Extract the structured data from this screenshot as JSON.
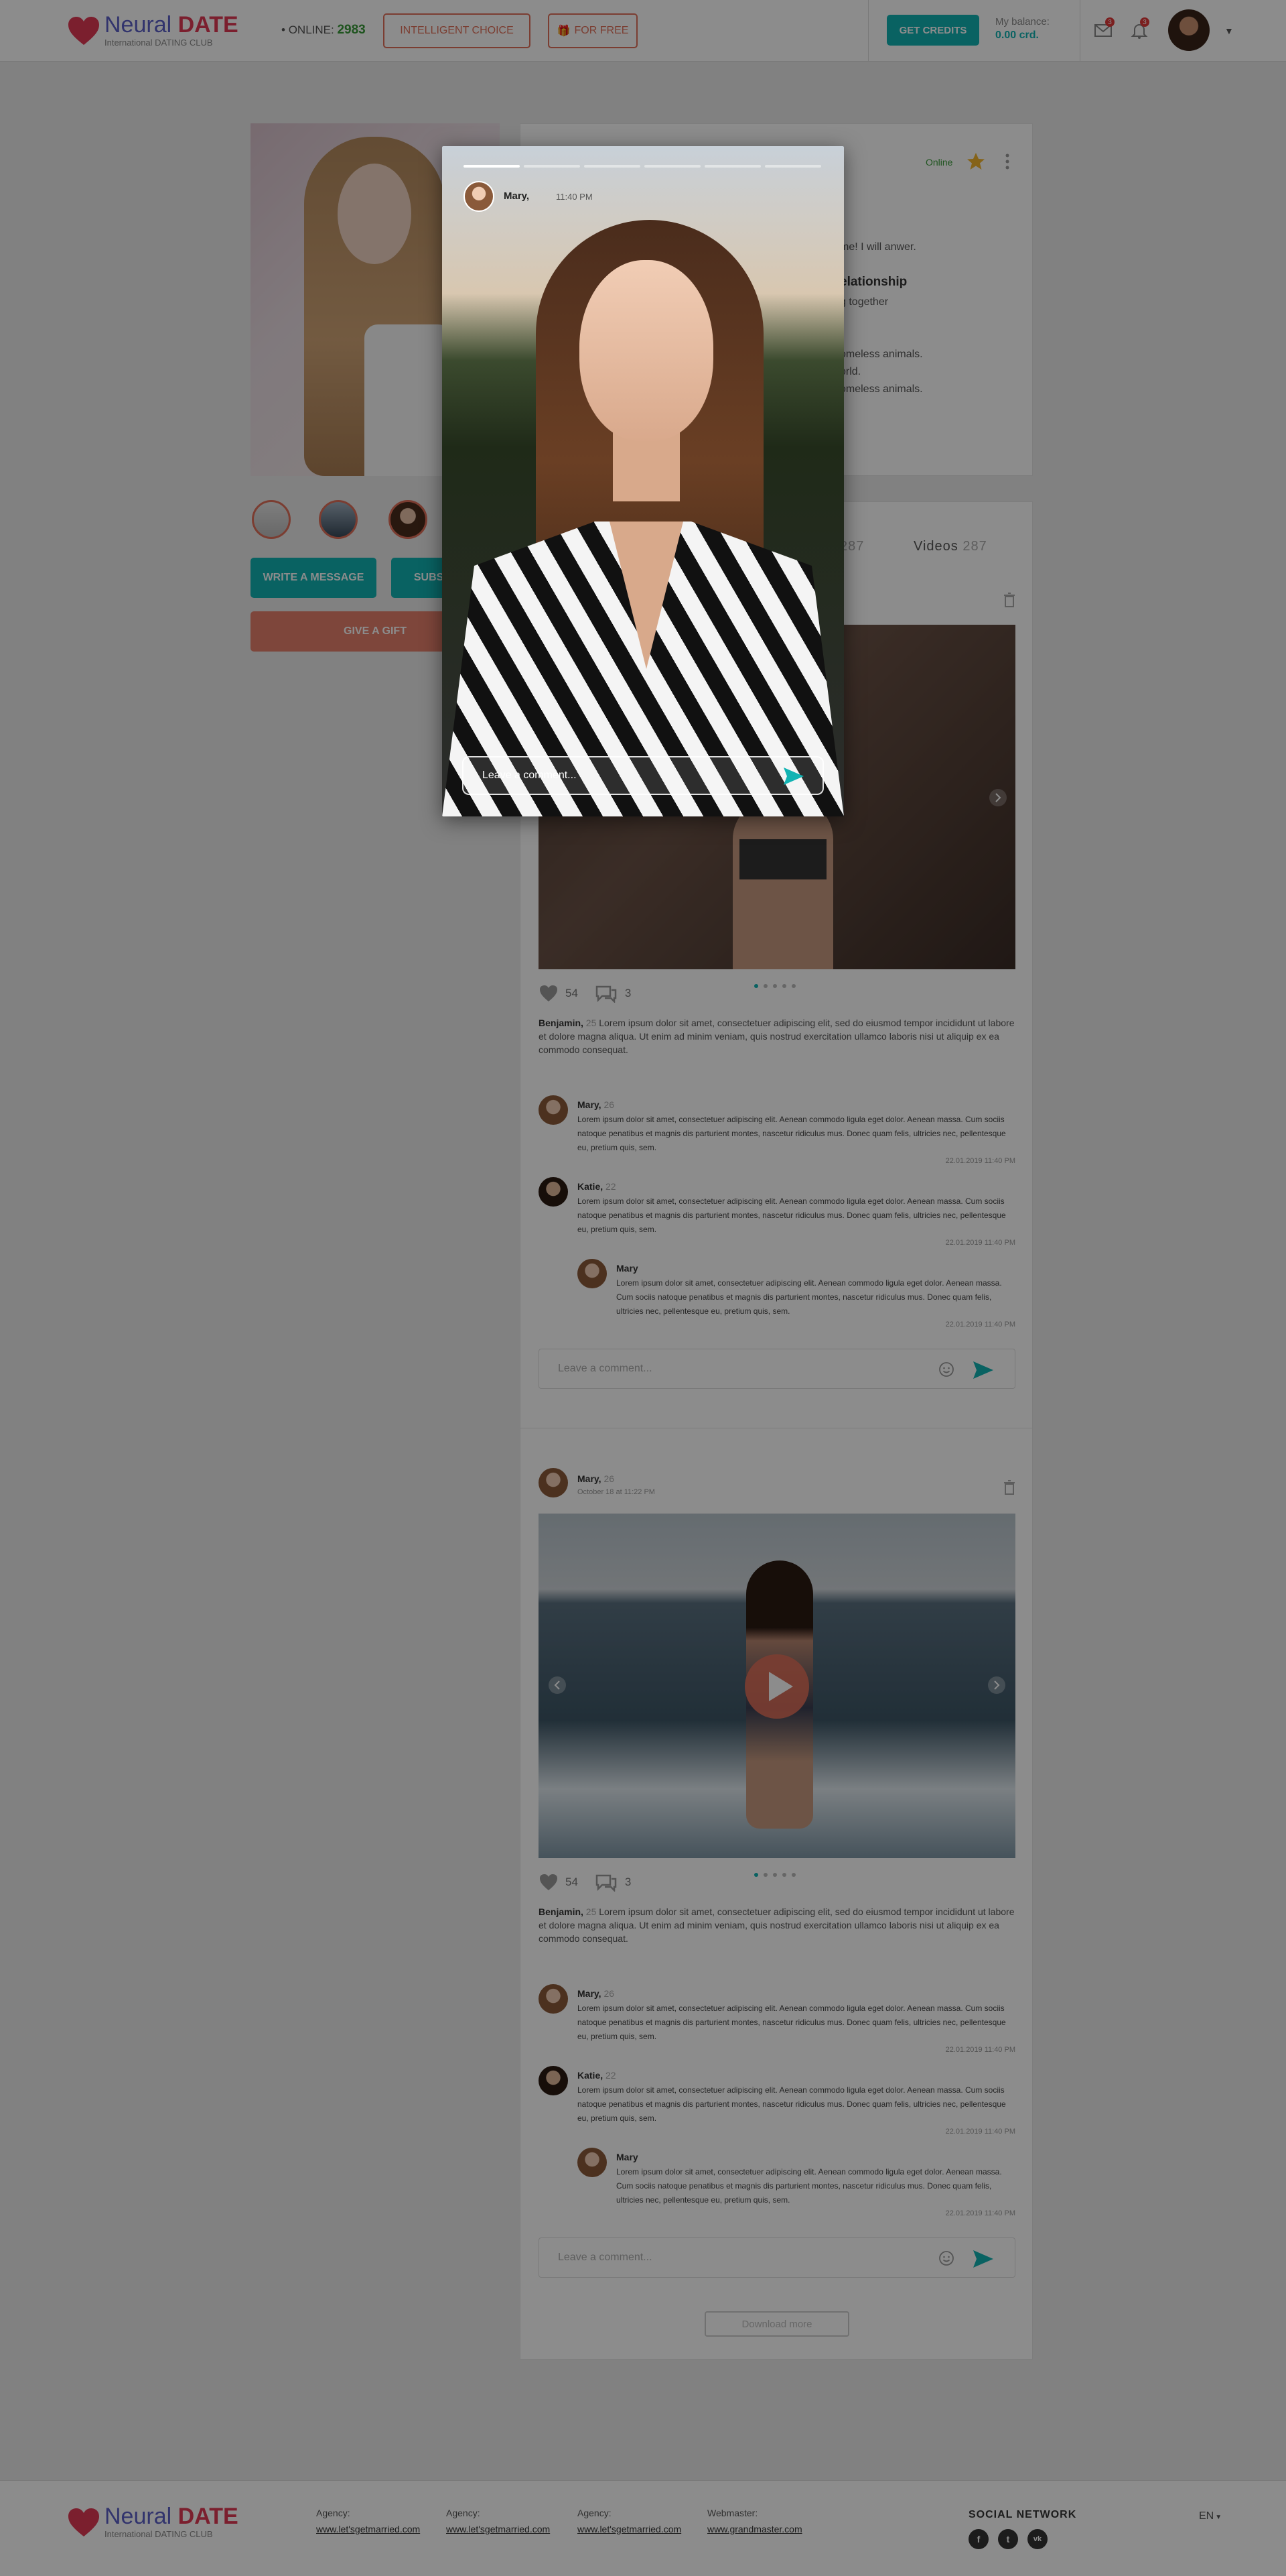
{
  "brand": {
    "name_part1": "Neural",
    "name_part2": "DATE",
    "tagline": "International DATING CLUB",
    "heart_color": "#e03a55"
  },
  "header": {
    "online_label": "ONLINE:",
    "online_count": "2983",
    "intelligent_choice": "INTELLIGENT CHOICE",
    "for_free": "FOR FREE",
    "get_credits": "GET CREDITS",
    "balance_label": "My balance:",
    "balance_value": "0.00 crd.",
    "mail_badge": "3",
    "bell_badge": "3",
    "accent_color": "#12b3b3"
  },
  "profile": {
    "write_message": "WRITE A MESSAGE",
    "subscribe": "SUBSCRIBE",
    "give_gift": "GIVE A GIFT",
    "status": "Online",
    "about_lines": [
      "me! I will anwer."
    ],
    "relationship_heading": "elationship",
    "relationship_lines": [
      "g together"
    ],
    "interest_lines": [
      "omeless animals.",
      "orld.",
      "omeless animals."
    ]
  },
  "tabs": {
    "photos_count": "287",
    "videos_label": "Videos",
    "videos_count": "287"
  },
  "posts": [
    {
      "likes": "54",
      "comments_count": "3",
      "caption_author": "Benjamin,",
      "caption_age": "25",
      "caption": "Lorem ipsum dolor sit amet, consectetuer adipiscing elit, sed do eiusmod tempor incididunt ut labore et dolore magna aliqua. Ut enim ad minim veniam, quis nostrud exercitation ullamco laboris nisi ut aliquip ex ea commodo consequat.",
      "comments": [
        {
          "name": "Mary,",
          "age": "26",
          "text": "Lorem ipsum dolor sit amet, consectetuer adipiscing elit. Aenean commodo ligula eget dolor. Aenean massa. Cum sociis natoque penatibus et magnis dis parturient montes, nascetur ridiculus mus. Donec quam felis, ultricies nec, pellentesque eu, pretium quis, sem.",
          "time": "22.01.2019 11:40 PM"
        },
        {
          "name": "Katie,",
          "age": "22",
          "text": "Lorem ipsum dolor sit amet, consectetuer adipiscing elit. Aenean commodo ligula eget dolor. Aenean massa. Cum sociis natoque penatibus et magnis dis parturient montes, nascetur ridiculus mus. Donec quam felis, ultricies nec, pellentesque eu, pretium quis, sem.",
          "time": "22.01.2019 11:40 PM"
        },
        {
          "name": "Mary",
          "age": "",
          "text": "Lorem ipsum dolor sit amet, consectetuer adipiscing elit. Aenean commodo ligula eget dolor. Aenean massa. Cum sociis natoque penatibus et magnis dis parturient montes, nascetur ridiculus mus. Donec quam felis, ultricies nec, pellentesque eu, pretium quis, sem.",
          "time": "22.01.2019 11:40 PM"
        }
      ],
      "comment_placeholder": "Leave a comment..."
    },
    {
      "author": "Mary,",
      "age": "26",
      "date": "October 18 at 11:22 PM",
      "likes": "54",
      "comments_count": "3",
      "caption_author": "Benjamin,",
      "caption_age": "25",
      "caption": "Lorem ipsum dolor sit amet, consectetuer adipiscing elit, sed do eiusmod tempor incididunt ut labore et dolore magna aliqua. Ut enim ad minim veniam, quis nostrud exercitation ullamco laboris nisi ut aliquip ex ea commodo consequat.",
      "comments": [
        {
          "name": "Mary,",
          "age": "26",
          "text": "Lorem ipsum dolor sit amet, consectetuer adipiscing elit. Aenean commodo ligula eget dolor. Aenean massa. Cum sociis natoque penatibus et magnis dis parturient montes, nascetur ridiculus mus. Donec quam felis, ultricies nec, pellentesque eu, pretium quis, sem.",
          "time": "22.01.2019 11:40 PM"
        },
        {
          "name": "Katie,",
          "age": "22",
          "text": "Lorem ipsum dolor sit amet, consectetuer adipiscing elit. Aenean commodo ligula eget dolor. Aenean massa. Cum sociis natoque penatibus et magnis dis parturient montes, nascetur ridiculus mus. Donec quam felis, ultricies nec, pellentesque eu, pretium quis, sem.",
          "time": "22.01.2019 11:40 PM"
        },
        {
          "name": "Mary",
          "age": "",
          "text": "Lorem ipsum dolor sit amet, consectetuer adipiscing elit. Aenean commodo ligula eget dolor. Aenean massa. Cum sociis natoque penatibus et magnis dis parturient montes, nascetur ridiculus mus. Donec quam felis, ultricies nec, pellentesque eu, pretium quis, sem.",
          "time": "22.01.2019 11:40 PM"
        }
      ],
      "comment_placeholder": "Leave a comment..."
    }
  ],
  "download_more": "Download more",
  "story": {
    "name": "Mary,",
    "time": "11:40 PM",
    "segments_total": 6,
    "segment_active": 1,
    "comment_placeholder": "Leave a comment..."
  },
  "footer": {
    "agency_label": "Agency:",
    "agencies": [
      "www.let'sgetmarried.com",
      "www.let'sgetmarried.com",
      "www.let'sgetmarried.com"
    ],
    "webmaster_label": "Webmaster:",
    "webmaster": "www.grandmaster.com",
    "social_title": "SOCIAL NETWORK",
    "social": [
      "facebook-icon",
      "twitter-icon",
      "vk-icon"
    ],
    "lang": "EN"
  }
}
